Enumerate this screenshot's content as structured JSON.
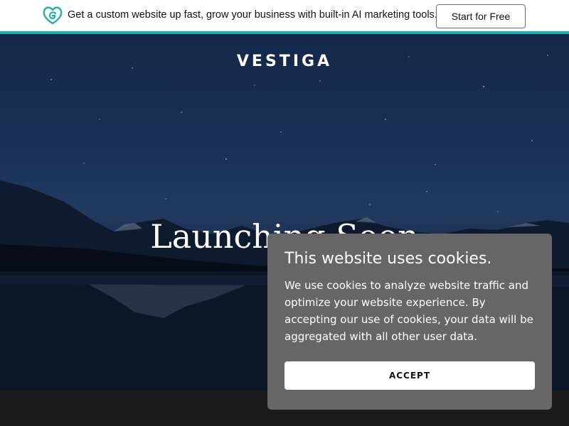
{
  "promo": {
    "logo_icon": "godaddy-logo-icon",
    "text": "Get a custom website up fast, grow your business with built-in AI marketing tools.",
    "cta_label": "Start for Free",
    "accent_color": "#1bb0b0"
  },
  "hero": {
    "brand": "VESTIGA",
    "headline": "Launching Soon"
  },
  "cookie": {
    "title": "This website uses cookies.",
    "body": "We use cookies to analyze website traffic and optimize your website experience. By accepting our use of cookies, your data will be aggregated with all other user data.",
    "accept_label": "ACCEPT"
  }
}
